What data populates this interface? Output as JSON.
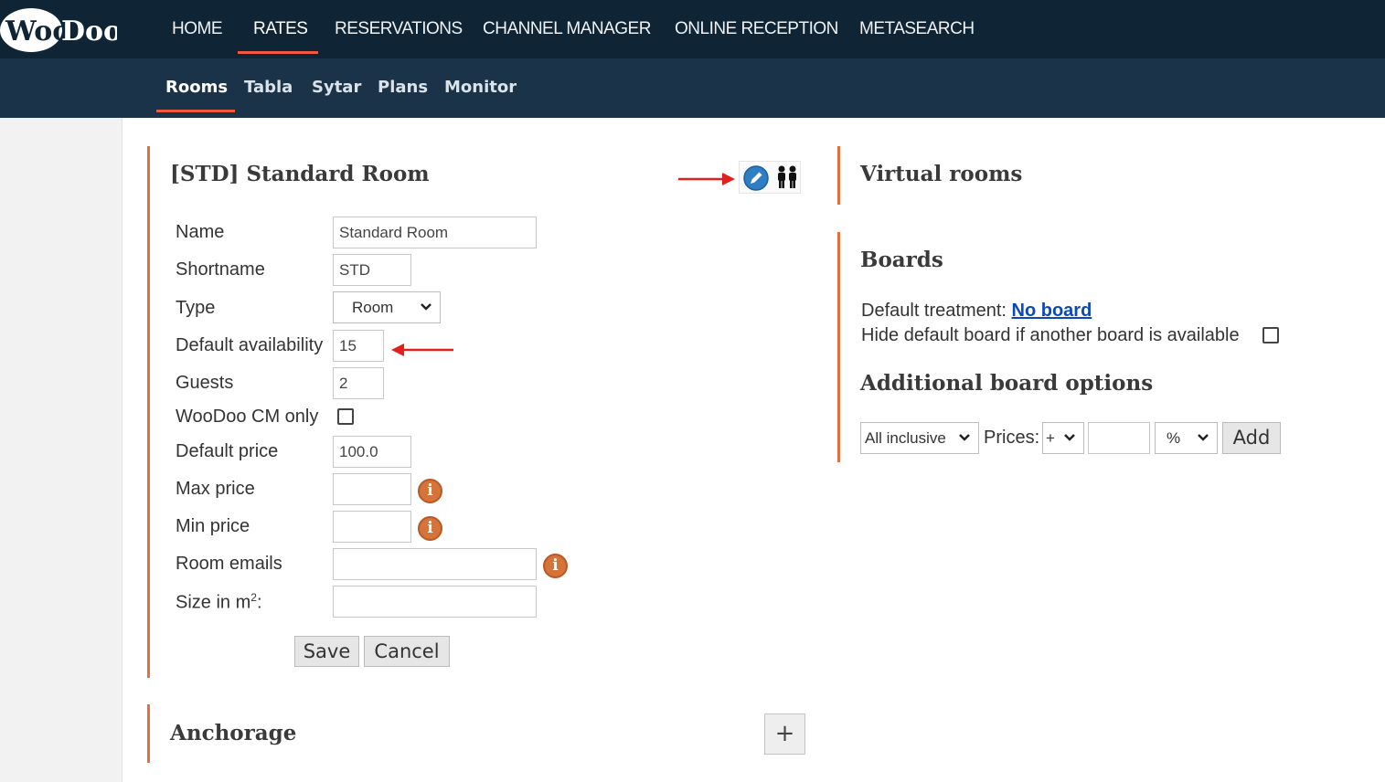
{
  "header": {
    "logo_text": "WooDoo",
    "nav": [
      "HOME",
      "RATES",
      "RESERVATIONS",
      "CHANNEL MANAGER",
      "ONLINE RECEPTION",
      "METASEARCH"
    ],
    "active_nav": "RATES"
  },
  "subnav": {
    "items": [
      "Rooms",
      "Tabla",
      "Sytar",
      "Plans",
      "Monitor"
    ],
    "active": "Rooms"
  },
  "room_panel": {
    "title": "[STD] Standard Room",
    "fields": {
      "name_label": "Name",
      "name_value": "Standard Room",
      "shortname_label": "Shortname",
      "shortname_value": "STD",
      "type_label": "Type",
      "type_value": "Room",
      "default_availability_label": "Default availability",
      "default_availability_value": "15",
      "guests_label": "Guests",
      "guests_value": "2",
      "cm_only_label": "WooDoo CM only",
      "default_price_label": "Default price",
      "default_price_value": "100.0",
      "max_price_label": "Max price",
      "max_price_value": "",
      "min_price_label": "Min price",
      "min_price_value": "",
      "room_emails_label": "Room emails",
      "room_emails_value": "",
      "size_label": "Size in m",
      "size_sup": "2",
      "size_suffix": ":",
      "size_value": ""
    },
    "save_label": "Save",
    "cancel_label": "Cancel"
  },
  "anchorage": {
    "title": "Anchorage",
    "add_label": "+"
  },
  "virtual_rooms": {
    "title": "Virtual rooms"
  },
  "boards": {
    "title": "Boards",
    "default_treatment_label": "Default treatment:",
    "default_treatment_value": "No board",
    "hide_default_label": "Hide default board if another board is available",
    "additional_title": "Additional board options",
    "board_select": "All inclusive",
    "prices_label": "Prices:",
    "sign_select": "+",
    "amount_value": "",
    "unit_select": "%",
    "add_label": "Add"
  },
  "colors": {
    "topbar": "#0f2536",
    "subbar": "#1b3348",
    "accent": "#f0573c",
    "panel_bar": "#e5703f",
    "info": "#d4733a",
    "annotation_arrow": "#e0201c"
  }
}
